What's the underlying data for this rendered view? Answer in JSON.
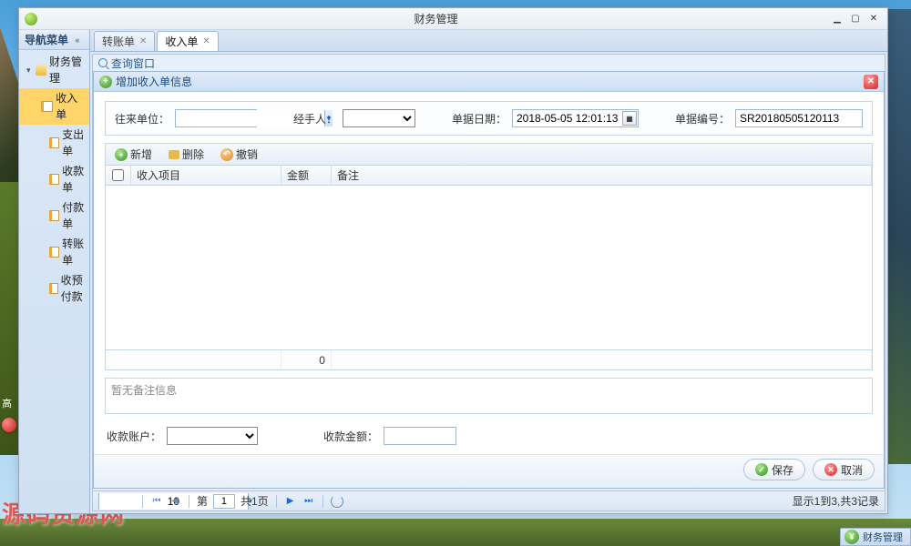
{
  "window": {
    "title": "财务管理"
  },
  "nav": {
    "header": "导航菜单",
    "root": "财务管理",
    "items": [
      "收入单",
      "支出单",
      "收款单",
      "付款单",
      "转账单",
      "收预付款"
    ],
    "selectedIndex": 0
  },
  "tabs": [
    {
      "label": "转账单",
      "active": false
    },
    {
      "label": "收入单",
      "active": true
    }
  ],
  "searchBar": "查询窗口",
  "modal": {
    "title": "增加收入单信息",
    "form": {
      "partyLabel": "往来单位：",
      "handlerLabel": "经手人：",
      "dateLabel": "单据日期：",
      "dateValue": "2018-05-05 12:01:13",
      "docNoLabel": "单据编号：",
      "docNoValue": "SR20180505120113"
    },
    "gridToolbar": {
      "add": "新增",
      "delete": "删除",
      "undo": "撤销"
    },
    "gridHeaders": {
      "col1": "收入项目",
      "col2": "金额",
      "col3": "备注"
    },
    "gridFooter": {
      "amountTotal": "0"
    },
    "remarksPlaceholder": "暂无备注信息",
    "payment": {
      "accountLabel": "收款账户：",
      "amountLabel": "收款金额："
    },
    "buttons": {
      "save": "保存",
      "cancel": "取消"
    }
  },
  "pager": {
    "pageSize": "10",
    "currentPage": "1",
    "totalPagesText": "共1页",
    "info": "显示1到3,共3记录"
  },
  "statusCorner": "财务管理",
  "watermark": "源码资源网"
}
